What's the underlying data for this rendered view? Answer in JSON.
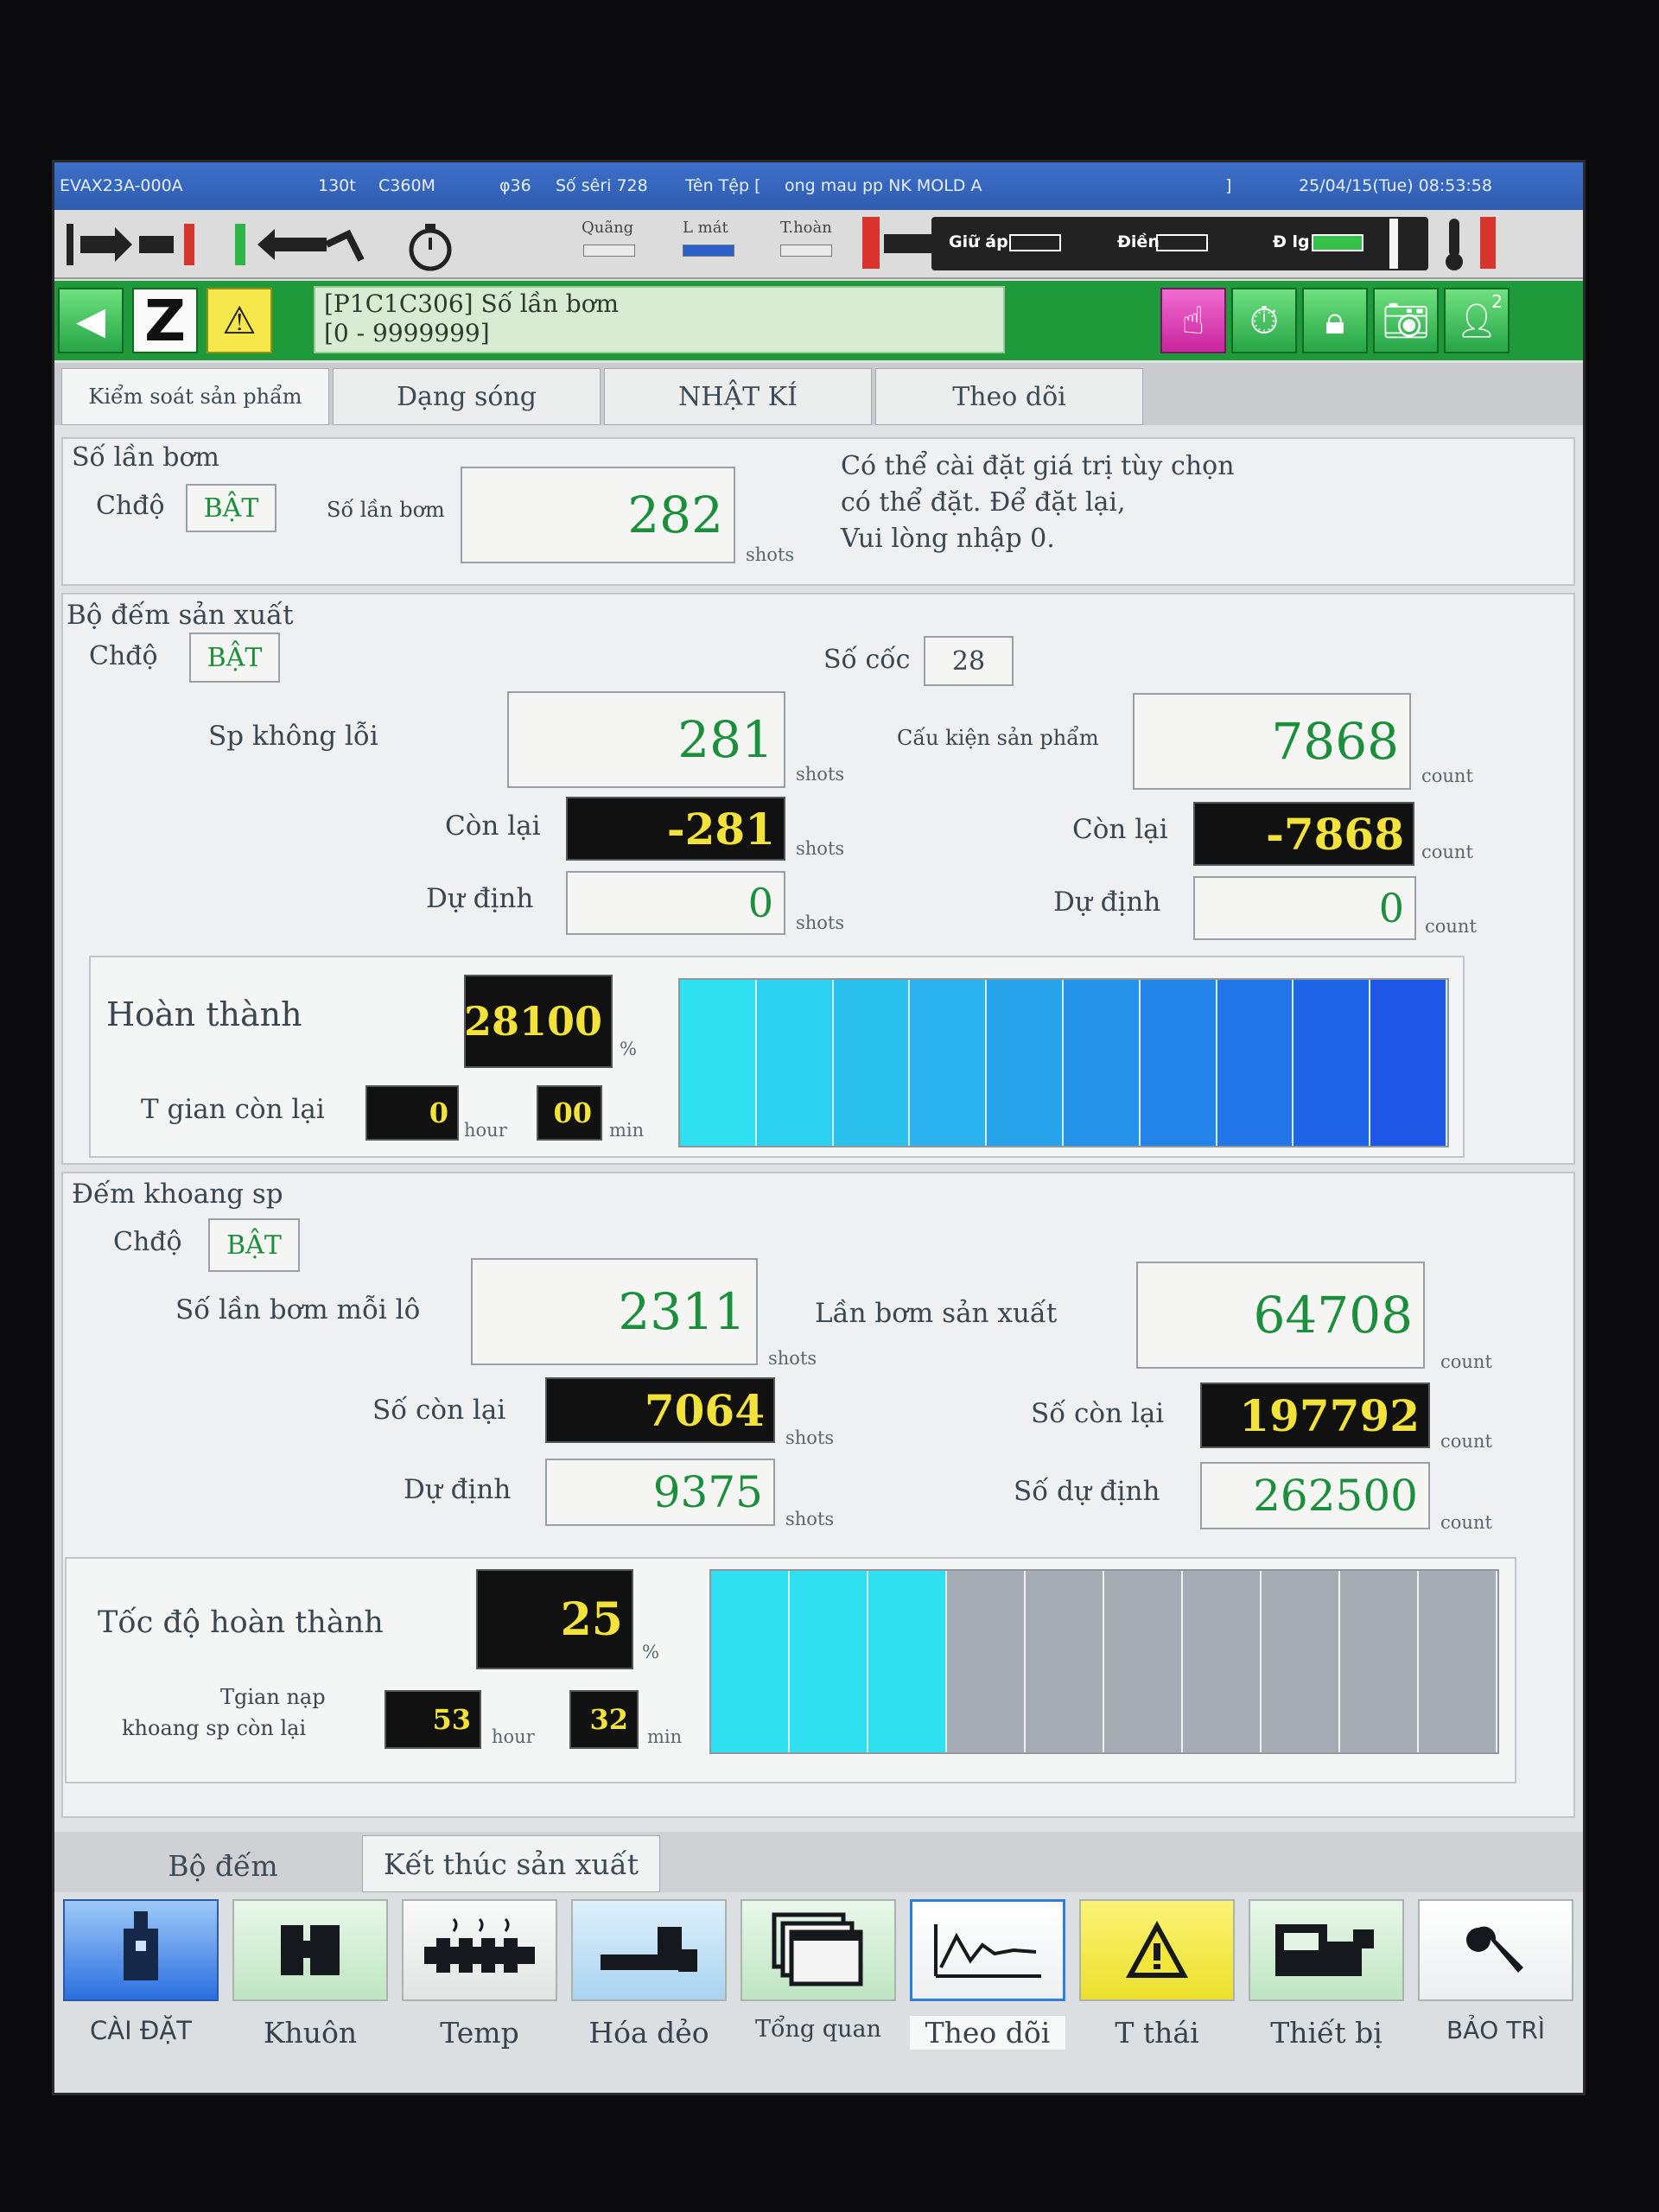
{
  "titlebar": {
    "model": "EVAX23A-000A",
    "tonnage": "130t",
    "unit_model": "C360M",
    "screw": "φ36",
    "serial": "Số sêri 728",
    "file_label": "Tên Tệp [",
    "file_name": "ong mau pp NK MOLD A",
    "file_close": "]",
    "datetime": "25/04/15(Tue) 08:53:58"
  },
  "statusbar": {
    "stroke_label": "Quãng",
    "cooling_label": "L mát",
    "complete_label": "T.hoàn",
    "hold_label": "Giữ áp",
    "fill_label": "Điền",
    "metering_label": "Đ lg"
  },
  "greenbar": {
    "message_line1": "[P1C1C306] Số lần bơm",
    "message_line2": "[0 - 9999999]",
    "badge": "2"
  },
  "tabs": [
    "Kiểm soát sản phẩm",
    "Dạng sóng",
    "NHẬT KÍ",
    "Theo dõi"
  ],
  "shot_counter": {
    "title": "Số lần bơm",
    "mode_label": "Chđộ",
    "mode_value": "BẬT",
    "count_label": "Số lần bơm",
    "count_value": "282",
    "unit": "shots",
    "note_line1": "Có thể cài đặt giá trị tùy chọn",
    "note_line2": "có thể đặt. Để đặt lại,",
    "note_line3": "Vui lòng nhập 0."
  },
  "production_counter": {
    "title": "Bộ đếm sản xuất",
    "mode_label": "Chđộ",
    "mode_value": "BẬT",
    "cavity_label": "Số cốc",
    "cavity_value": "28",
    "good_label": "Sp không lỗi",
    "good_value": "281",
    "parts_label": "Cấu kiện sản phẩm",
    "parts_value": "7868",
    "remain_label": "Còn lại",
    "remain_shots": "-281",
    "remain_parts": "-7868",
    "plan_label": "Dự định",
    "plan_shots": "0",
    "plan_parts": "0",
    "unit_shots": "shots",
    "unit_count": "count",
    "complete_label": "Hoàn thành",
    "complete_value": "28100",
    "percent": "%",
    "time_label": "T gian còn lại",
    "hours": "0",
    "minutes": "00",
    "hour_unit": "hour",
    "min_unit": "min",
    "progress_fraction": 1.0
  },
  "cavity_counter": {
    "title": "Đếm khoang sp",
    "mode_label": "Chđộ",
    "mode_value": "BẬT",
    "shots_per_lot_label": "Số lần bơm mỗi lô",
    "shots_per_lot_value": "2311",
    "prod_shots_label": "Lần bơm sản xuất",
    "prod_shots_value": "64708",
    "remain_label": "Số còn lại",
    "remain_shots": "7064",
    "remain_count": "197792",
    "plan_label": "Dự định",
    "plan_count_label": "Số dự định",
    "plan_shots": "9375",
    "plan_count": "262500",
    "unit_shots": "shots",
    "unit_count": "count",
    "speed_label": "Tốc độ hoàn thành",
    "speed_value": "25",
    "percent": "%",
    "time_label_line1": "Tgian nạp",
    "time_label_line2": "khoang sp còn lại",
    "hours": "53",
    "minutes": "32",
    "hour_unit": "hour",
    "min_unit": "min",
    "progress_fraction": 0.3
  },
  "bottom_tabs": [
    "Bộ đếm",
    "Kết thúc sản xuất"
  ],
  "nav": [
    "CÀI ĐẶT",
    "Khuôn",
    "Temp",
    "Hóa dẻo",
    "Tổng quan",
    "Theo dõi",
    "T thái",
    "Thiết bị",
    "BẢO TRÌ"
  ],
  "colors": {
    "title_bar": "#3d6fc9",
    "green_bar": "#1f9a3a",
    "value_green": "#1b8f3c",
    "value_yellow": "#f2e23a",
    "progress_start": "#2ee0f0",
    "progress_end": "#1e56e6",
    "progress_empty": "#a6acb4"
  }
}
